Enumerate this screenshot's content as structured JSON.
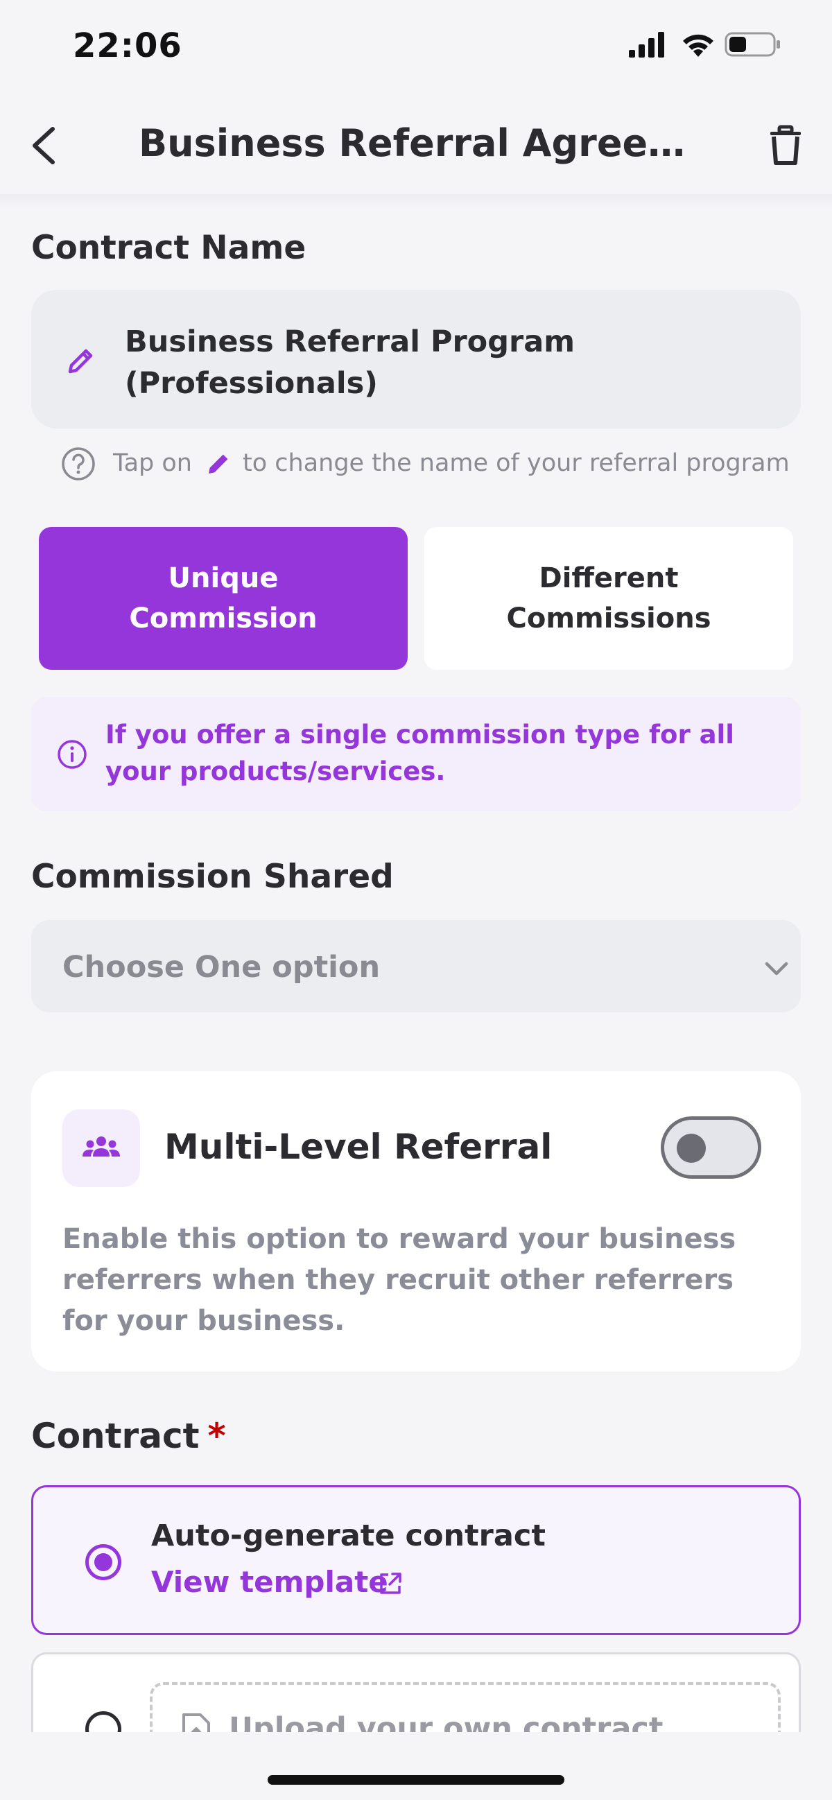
{
  "status_bar": {
    "time": "22:06",
    "icons": [
      "signal-icon",
      "wifi-icon",
      "battery-icon"
    ]
  },
  "header": {
    "title": "Business Referral Agreem...",
    "back_icon": "chevron-left-icon",
    "delete_icon": "trash-icon"
  },
  "contract_name": {
    "label": "Contract Name",
    "value": "Business Referral Program (Professionals)",
    "edit_icon": "pencil-icon",
    "hint_before": "Tap on",
    "hint_after": "to change the name of your referral program",
    "help_icon": "question-circle-icon"
  },
  "commission_mode": {
    "options": [
      {
        "label": "Unique Commission",
        "selected": true
      },
      {
        "label": "Different Commissions",
        "selected": false
      }
    ],
    "info_icon": "info-circle-icon",
    "info_text": "If you offer a single commission type for all your products/services."
  },
  "commission_shared": {
    "label": "Commission Shared",
    "placeholder": "Choose One option"
  },
  "multi_level": {
    "title": "Multi-Level Referral",
    "icon": "people-icon",
    "enabled": false,
    "description": "Enable this option to reward your business referrers when they recruit other referrers for your business."
  },
  "contract": {
    "label": "Contract",
    "required_mark": "*",
    "options": [
      {
        "title": "Auto-generate contract",
        "link": "View template",
        "selected": true
      },
      {
        "title": "Upload your own contract",
        "selected": false
      }
    ]
  },
  "colors": {
    "accent": "#9536DB",
    "accent_light": "#F4EEFC",
    "background": "#F5F5F8",
    "field": "#ECEDF1",
    "required": "#C00000"
  }
}
